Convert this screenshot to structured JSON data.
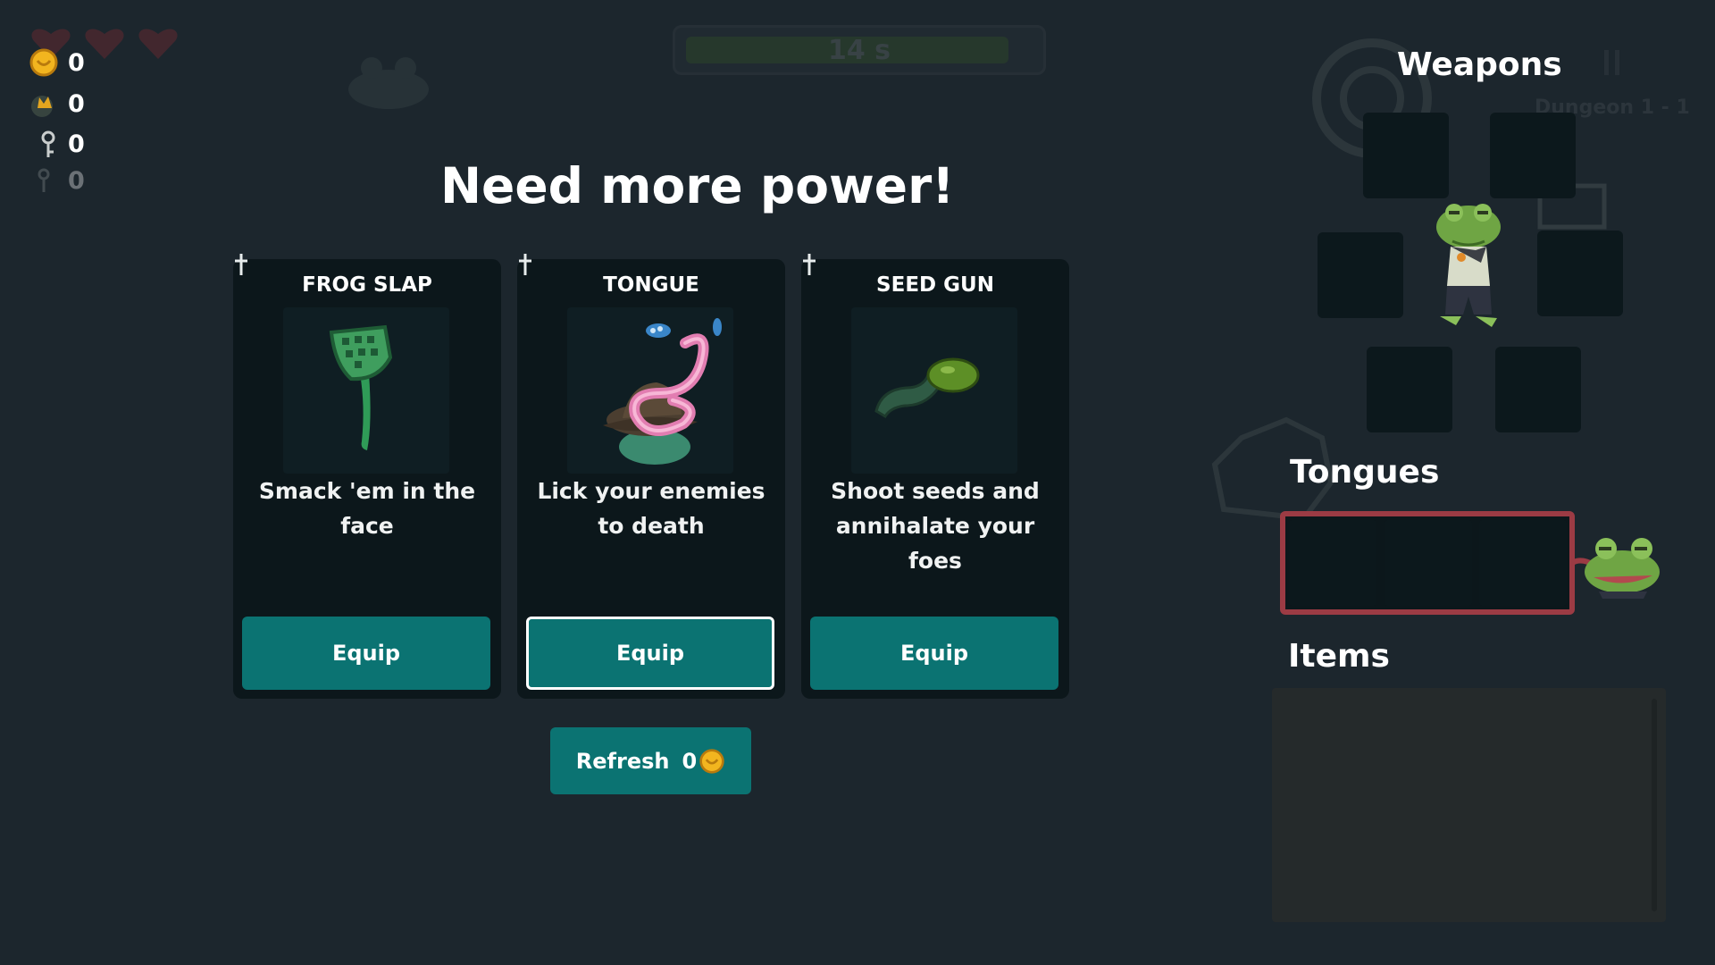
{
  "hud": {
    "hearts": 3,
    "coins": "0",
    "crowns": "0",
    "keys": "0",
    "extra": "0",
    "timer": "14 s",
    "timer_fraction": 0.93,
    "dungeon": "Dungeon 1 - 1"
  },
  "shop": {
    "title": "Need more power!",
    "cards": [
      {
        "name": "FROG SLAP",
        "description": "Smack 'em in the face",
        "button": "Equip",
        "icon": "fly-swatter-icon"
      },
      {
        "name": "TONGUE",
        "description": "Lick your enemies to death",
        "button": "Equip",
        "icon": "tongue-frog-icon"
      },
      {
        "name": "SEED GUN",
        "description": "Shoot seeds and annihalate your foes",
        "button": "Equip",
        "icon": "seed-gun-icon"
      }
    ],
    "refresh_label": "Refresh",
    "refresh_cost": "0"
  },
  "panel": {
    "weapons_title": "Weapons",
    "tongues_title": "Tongues",
    "items_title": "Items"
  },
  "colors": {
    "background": "#1c262d",
    "card": "#0c171b",
    "button": "#0b7372",
    "tongue_frame": "#9c3b44",
    "coin": "#f2b51f"
  }
}
